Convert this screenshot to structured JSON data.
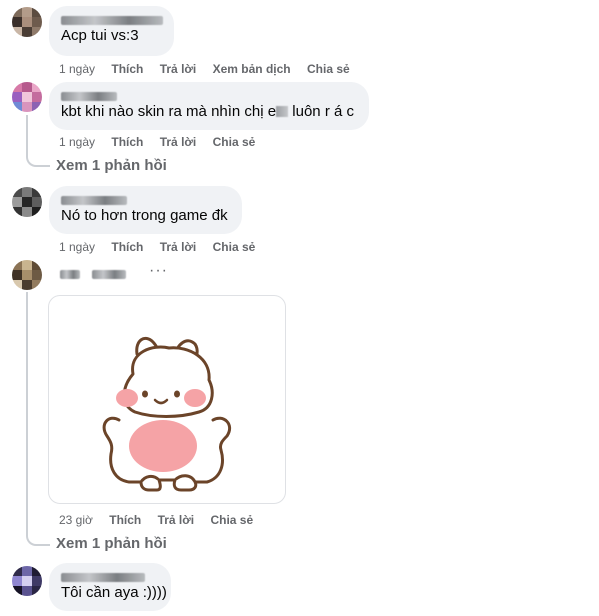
{
  "comments": [
    {
      "text": "Acp tui vs:3",
      "actions": [
        "1 ngày",
        "Thích",
        "Trả lời",
        "Xem bản dịch",
        "Chia sẻ"
      ]
    },
    {
      "text_before": "kbt khi nào skin ra mà nhìn chị e",
      "text_after": " luôn r á c",
      "actions": [
        "1 ngày",
        "Thích",
        "Trả lời",
        "Chia sẻ"
      ],
      "view_replies": "Xem 1 phản hồi"
    },
    {
      "text": "Nó to hơn trong game đk",
      "actions": [
        "1 ngày",
        "Thích",
        "Trả lời",
        "Chia sẻ"
      ]
    },
    {
      "sticker": "bunny-sticker",
      "more_options": "···",
      "actions": [
        "23 giờ",
        "Thích",
        "Trả lời",
        "Chia sẻ"
      ],
      "view_replies": "Xem 1 phản hồi"
    },
    {
      "text": "Tôi cần aya :))))"
    }
  ],
  "colors": {
    "bubble": "#f0f2f5",
    "muted": "#65676b",
    "sticker_pink": "#f5a3a6",
    "sticker_outline": "#6b4429"
  }
}
